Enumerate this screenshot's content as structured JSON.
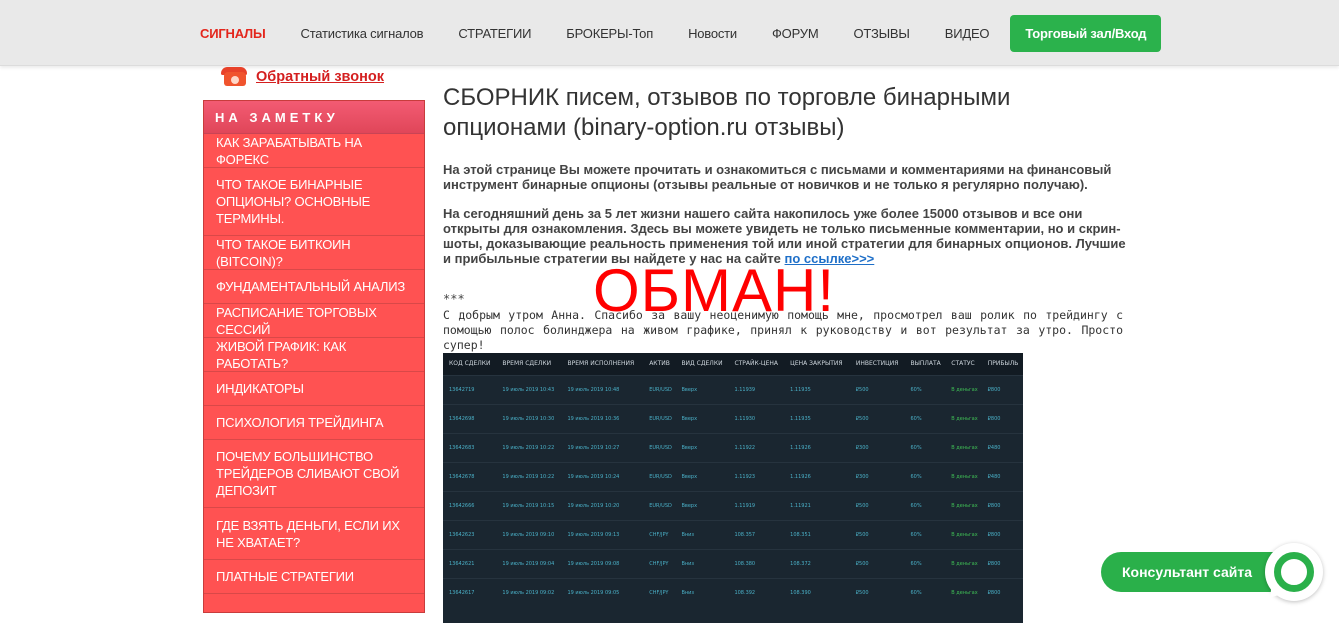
{
  "nav": {
    "items": [
      "СИГНАЛЫ",
      "Статистика сигналов",
      "СТРАТЕГИИ",
      "БРОКЕРЫ-Топ",
      "Новости",
      "ФОРУМ",
      "ОТЗЫВЫ",
      "ВИДЕО"
    ],
    "login_label": "Торговый зал/Вход"
  },
  "callback": {
    "label": "Обратный звонок"
  },
  "sidebar": {
    "heading": "НА ЗАМЕТКУ",
    "items": [
      "КАК ЗАРАБАТЫВАТЬ НА ФОРЕКС",
      "ЧТО ТАКОЕ БИНАРНЫЕ ОПЦИОНЫ? ОСНОВНЫЕ ТЕРМИНЫ.",
      "ЧТО ТАКОЕ БИТКОИН (BITCOIN)?",
      "ФУНДАМЕНТАЛЬНЫЙ АНАЛИЗ",
      "РАСПИСАНИЕ ТОРГОВЫХ СЕССИЙ",
      "ЖИВОЙ ГРАФИК: КАК РАБОТАТЬ?",
      "ИНДИКАТОРЫ",
      "ПСИХОЛОГИЯ ТРЕЙДИНГА",
      "ПОЧЕМУ БОЛЬШИНСТВО ТРЕЙДЕРОВ СЛИВАЮТ СВОЙ ДЕПОЗИТ",
      "ГДЕ ВЗЯТЬ ДЕНЬГИ, ЕСЛИ ИХ НЕ ХВАТАЕТ?",
      "ПЛАТНЫЕ СТРАТЕГИИ"
    ]
  },
  "content": {
    "title": "СБОРНИК писем, отзывов по торговле бинарными опционами (binary-option.ru отзывы)",
    "para1": "На этой странице Вы можете прочитать и ознакомиться с письмами и комментариями на финансовый инструмент бинарные опционы (отзывы реальные от новичков и не только я регулярно получаю).",
    "para2": "На сегодняшний день за 5 лет жизни нашего сайта накопилось уже более 15000 отзывов и все они открыты для ознакомления. Здесь вы можете увидеть не только письменные комментарии, но и скрин-шоты, доказывающие реальность применения той или иной стратегии для бинарных опционов. Лучшие и прибыльные стратегии вы найдете у нас на сайте",
    "para2_link": "по ссылке>>>",
    "stars": "***",
    "letter": "С добрым утром Анна. Спасибо за вашу неоценимую помощь мне, просмотрел ваш ролик по трейдингу с помощью полос болинджера на живом графике, принял к руководству и вот результат за утро. Просто супер!",
    "overlay": "ОБМАН!"
  },
  "trades": {
    "headers": [
      "КОД СДЕЛКИ",
      "ВРЕМЯ СДЕЛКИ",
      "ВРЕМЯ ИСПОЛНЕНИЯ",
      "АКТИВ",
      "ВИД СДЕЛКИ",
      "СТРАЙК-ЦЕНА",
      "ЦЕНА ЗАКРЫТИЯ",
      "ИНВЕСТИЦИЯ",
      "ВЫПЛАТА",
      "СТАТУС",
      "ПРИБЫЛЬ"
    ],
    "rows": [
      [
        "13642719",
        "19 июль 2019 10:43",
        "19 июль 2019 10:48",
        "EUR/USD",
        "Вверх",
        "1.11939",
        "1.11935",
        "₽500",
        "60%",
        "В деньгах",
        "₽800"
      ],
      [
        "13642698",
        "19 июль 2019 10:30",
        "19 июль 2019 10:36",
        "EUR/USD",
        "Вверх",
        "1.11930",
        "1.11935",
        "₽500",
        "60%",
        "В деньгах",
        "₽800"
      ],
      [
        "13642683",
        "19 июль 2019 10:22",
        "19 июль 2019 10:27",
        "EUR/USD",
        "Вверх",
        "1.11922",
        "1.11926",
        "₽300",
        "60%",
        "В деньгах",
        "₽480"
      ],
      [
        "13642678",
        "19 июль 2019 10:22",
        "19 июль 2019 10:24",
        "EUR/USD",
        "Вверх",
        "1.11923",
        "1.11926",
        "₽300",
        "60%",
        "В деньгах",
        "₽480"
      ],
      [
        "13642666",
        "19 июль 2019 10:15",
        "19 июль 2019 10:20",
        "EUR/USD",
        "Вверх",
        "1.11919",
        "1.11921",
        "₽500",
        "60%",
        "В деньгах",
        "₽800"
      ],
      [
        "13642623",
        "19 июль 2019 09:10",
        "19 июль 2019 09:13",
        "CHF/JPY",
        "Вниз",
        "108.357",
        "108.351",
        "₽500",
        "60%",
        "В деньгах",
        "₽800"
      ],
      [
        "13642621",
        "19 июль 2019 09:04",
        "19 июль 2019 09:08",
        "CHF/JPY",
        "Вниз",
        "108.380",
        "108.372",
        "₽500",
        "60%",
        "В деньгах",
        "₽800"
      ],
      [
        "13642617",
        "19 июль 2019 09:02",
        "19 июль 2019 09:05",
        "CHF/JPY",
        "Вниз",
        "108.392",
        "108.390",
        "₽500",
        "60%",
        "В деньгах",
        "₽800"
      ]
    ]
  },
  "consultant": {
    "label": "Консультант сайта"
  }
}
